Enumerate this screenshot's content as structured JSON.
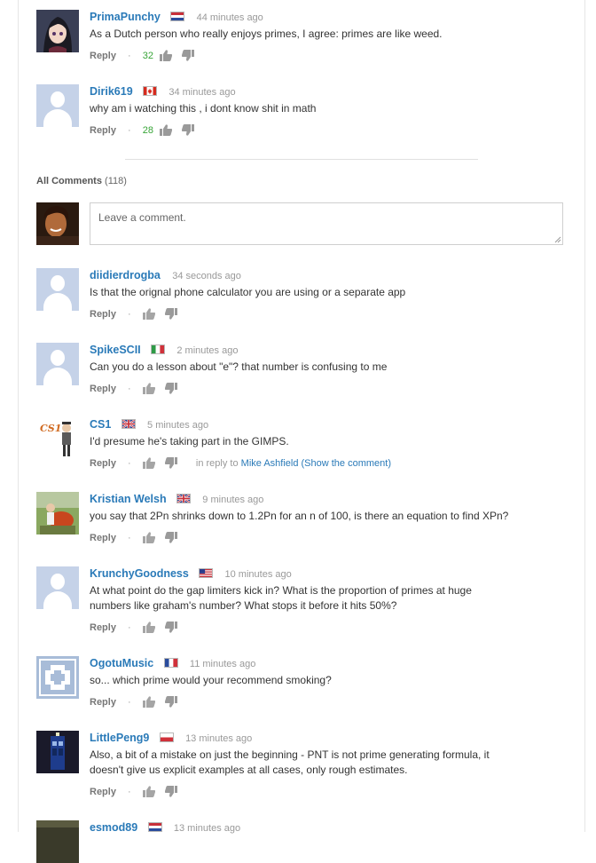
{
  "top_comments": [
    {
      "author": "PrimaPunchy",
      "flag": "nl",
      "time": "44 minutes ago",
      "text": "As a Dutch person who really enjoys primes, I agree: primes are like weed.",
      "reply": "Reply",
      "likes": "32"
    },
    {
      "author": "Dirik619",
      "flag": "ca",
      "time": "34 minutes ago",
      "text": "why am i watching this , i dont know shit in math",
      "reply": "Reply",
      "likes": "28"
    }
  ],
  "all_comments": {
    "label": "All Comments",
    "count": "(118)",
    "placeholder": "Leave a comment."
  },
  "comments": [
    {
      "author": "diidierdrogba",
      "time": "34 seconds ago",
      "text": "Is that the orignal phone calculator you are using or a separate app",
      "reply": "Reply"
    },
    {
      "author": "SpikeSCII",
      "flag": "it",
      "time": "2 minutes ago",
      "text": "Can you do a lesson about \"e\"? that number is confusing to me",
      "reply": "Reply"
    },
    {
      "author": "CS1",
      "flag": "gb",
      "time": "5 minutes ago",
      "text": "I'd presume he's taking part in the GIMPS.",
      "reply": "Reply",
      "in_reply_prefix": "in reply to",
      "in_reply_link": "Mike Ashfield (Show the comment)"
    },
    {
      "author": "Kristian Welsh",
      "flag": "gb",
      "time": "9 minutes ago",
      "text": "you say that 2Pn shrinks down to 1.2Pn for an n of 100, is there an equation to find XPn?",
      "reply": "Reply"
    },
    {
      "author": "KrunchyGoodness",
      "flag": "us",
      "time": "10 minutes ago",
      "text_line1": "At what point do the gap limiters kick in? What is the proportion of primes at huge",
      "text_line2": "numbers like graham's number? What stops it before it hits 50%?",
      "reply": "Reply"
    },
    {
      "author": "OgotuMusic",
      "flag": "fr",
      "time": "11 minutes ago",
      "text": "so... which prime would your recommend smoking?",
      "reply": "Reply"
    },
    {
      "author": "LittlePeng9",
      "flag": "pl",
      "time": "13 minutes ago",
      "text_line1": "Also, a bit of a mistake on just the beginning - PNT is not prime generating formula, it",
      "text_line2": "doesn't give us explicit examples at all cases, only rough estimates.",
      "reply": "Reply"
    },
    {
      "author": "esmod89",
      "flag": "nl",
      "time": "13 minutes ago"
    }
  ],
  "colors": {
    "author": "#2a7ab8",
    "likes": "#38a538",
    "default_avatar": "#c5d2e8"
  },
  "icons": {
    "like": "thumbs-up-icon",
    "dislike": "thumbs-down-icon",
    "dot": "·"
  }
}
